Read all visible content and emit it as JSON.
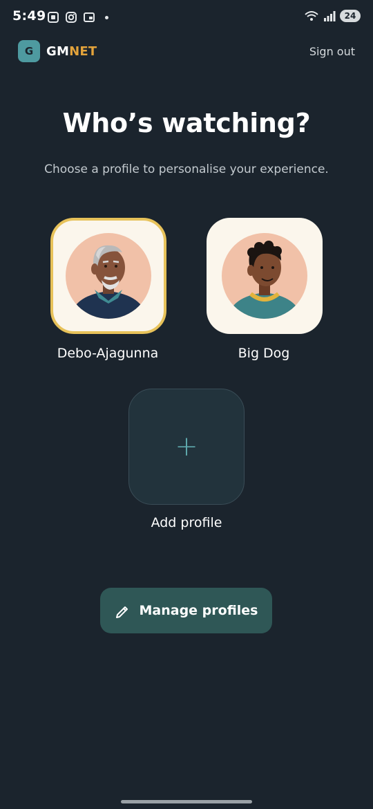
{
  "status_bar": {
    "time": "5:49",
    "battery": "24",
    "icons": [
      "screenshot-icon",
      "instagram-icon",
      "cast-icon",
      "wifi-icon",
      "signal-icon"
    ]
  },
  "header": {
    "logo_letter": "G",
    "brand_part1": "GM",
    "brand_part2": "NET",
    "sign_out": "Sign out"
  },
  "main": {
    "title": "Who’s watching?",
    "subtitle": "Choose a profile to personalise your experience.",
    "profiles": [
      {
        "name": "Debo-Ajagunna",
        "avatar": "elderly-man-avatar",
        "selected": true
      },
      {
        "name": "Big Dog",
        "avatar": "young-man-avatar",
        "selected": false
      }
    ],
    "add_profile": {
      "icon": "plus-icon",
      "label": "Add profile"
    },
    "manage_button": {
      "icon": "pencil-icon",
      "label": "Manage profiles"
    }
  },
  "colors": {
    "background": "#1b242d",
    "accent": "#e3a33b",
    "selected_border": "#e7c25a",
    "teal": "#4e9aa0",
    "button": "#2f5756"
  }
}
